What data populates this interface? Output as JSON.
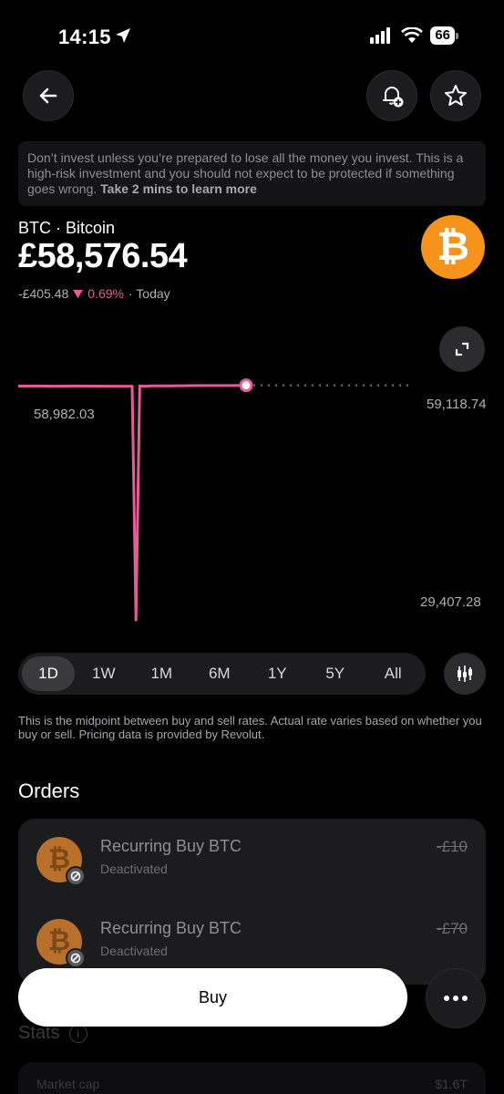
{
  "status_bar": {
    "time": "14:15",
    "battery": "66"
  },
  "warning": {
    "text": "Don’t invest unless you’re prepared to lose all the money you invest. This is a high-risk investment and you should not expect to be protected if something goes wrong.",
    "link": "Take 2 mins to learn more"
  },
  "asset": {
    "name": "BTC · Bitcoin",
    "price": "£58,576.54",
    "change_abs": "-£405.48",
    "change_pct": "0.69%",
    "period": "· Today",
    "logo_glyph": "₿"
  },
  "chart_data": {
    "type": "line",
    "series": [
      {
        "x": [
          0,
          5,
          10,
          15,
          20,
          25,
          30,
          31,
          32,
          33,
          34,
          35,
          40,
          45,
          50,
          55,
          60
        ],
        "values": [
          58950,
          58960,
          58940,
          58955,
          58945,
          58935,
          58930,
          29407.28,
          58982.03,
          58940,
          58950,
          58970,
          58980,
          59000,
          59010,
          59020,
          59040
        ]
      }
    ],
    "y_labels": [
      "59,118.74",
      "58,982.03",
      "29,407.28"
    ],
    "ylim": [
      29407.28,
      59118.74
    ],
    "line_color": "#e95a9a",
    "current_value": 59040
  },
  "ranges": [
    "1D",
    "1W",
    "1M",
    "6M",
    "1Y",
    "5Y",
    "All"
  ],
  "active_range": "1D",
  "disclaimer": "This is the midpoint between buy and sell rates. Actual rate varies based on whether you buy or sell. Pricing data is provided by Revolut.",
  "orders": {
    "title": "Orders",
    "items": [
      {
        "title": "Recurring Buy BTC",
        "status": "Deactivated",
        "amount": "-£10"
      },
      {
        "title": "Recurring Buy BTC",
        "status": "Deactivated",
        "amount": "-£70"
      }
    ]
  },
  "stats": {
    "title": "Stats",
    "rows": [
      {
        "label": "Market cap",
        "value": "$1.6T"
      }
    ]
  },
  "actions": {
    "buy_label": "Buy"
  },
  "icons": {
    "back": "arrow-left-icon",
    "alert": "bell-plus-icon",
    "favourite": "star-icon",
    "expand": "expand-icon",
    "candles": "candlestick-icon",
    "more": "more-dots-icon"
  }
}
